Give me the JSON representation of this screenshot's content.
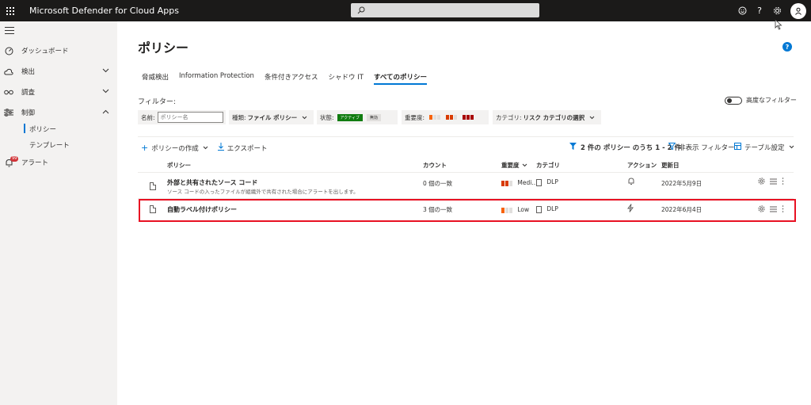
{
  "app": {
    "title": "Microsoft Defender for Cloud Apps"
  },
  "colors": {
    "accent": "#0078d4",
    "topbar": "#1b1a19",
    "highlight": "#e81123",
    "active_green": "#107c10",
    "sev_high": "#a80000",
    "sev_med": "#d83b01",
    "sev_low": "#f7630c"
  },
  "topbar": {
    "icons": [
      "smiley-icon",
      "help-icon",
      "gear-icon",
      "user-avatar-icon"
    ],
    "help_glyph": "?"
  },
  "sidebar": {
    "items": [
      {
        "label": "ダッシュボード",
        "icon": "dashboard-icon"
      },
      {
        "label": "検出",
        "icon": "cloud-icon"
      },
      {
        "label": "調査",
        "icon": "glasses-icon"
      },
      {
        "label": "制御",
        "icon": "sliders-icon"
      },
      {
        "label": "アラート",
        "icon": "alert-icon",
        "badge": "99"
      }
    ],
    "subitems": [
      {
        "label": "ポリシー",
        "active": true
      },
      {
        "label": "テンプレート",
        "active": false
      }
    ]
  },
  "page": {
    "title": "ポリシー",
    "help_glyph": "?"
  },
  "tabs": [
    {
      "label": "脅威検出",
      "active": false
    },
    {
      "label": "Information Protection",
      "active": false
    },
    {
      "label": "条件付きアクセス",
      "active": false
    },
    {
      "label": "シャドウ IT",
      "active": false
    },
    {
      "label": "すべてのポリシー",
      "active": true
    }
  ],
  "filters": {
    "label": "フィルター:",
    "advanced": "高度なフィルター",
    "name_label": "名前:",
    "name_placeholder": "ポリシー名",
    "type_label": "種類:",
    "type_value": "ファイル ポリシー",
    "status_label": "状態:",
    "status_active": "アクティブ",
    "status_inactive": "無効",
    "severity_label": "重要度:",
    "category_label": "カテゴリ:",
    "category_value": "リスク カテゴリの選択"
  },
  "commands": {
    "create": "ポリシーの作成",
    "export": "エクスポート",
    "count_text": "2 件の ポリシー のうち 1 - 2 件",
    "hide_filters": "非表示 フィルター",
    "table_settings": "テーブル設定"
  },
  "table": {
    "headers": {
      "policy": "ポリシー",
      "count": "カウント",
      "severity": "重要度",
      "category": "カテゴリ",
      "action": "アクション",
      "updated": "更新日"
    },
    "rows": [
      {
        "name": "外部と共有されたソース コード",
        "description": "ソース コードの入ったファイルが組織外で共有された場合にアラートを出します。",
        "count": "0 個の一致",
        "severity": "Medi...",
        "severity_level": "medium",
        "category": "DLP",
        "action_icon": "bell-icon",
        "updated": "2022年5月9日"
      },
      {
        "name": "自動ラベル付けポリシー",
        "description": "",
        "count": "3 個の一致",
        "severity": "Low",
        "severity_level": "low",
        "category": "DLP",
        "action_icon": "governance-icon",
        "updated": "2022年6月4日"
      }
    ]
  }
}
